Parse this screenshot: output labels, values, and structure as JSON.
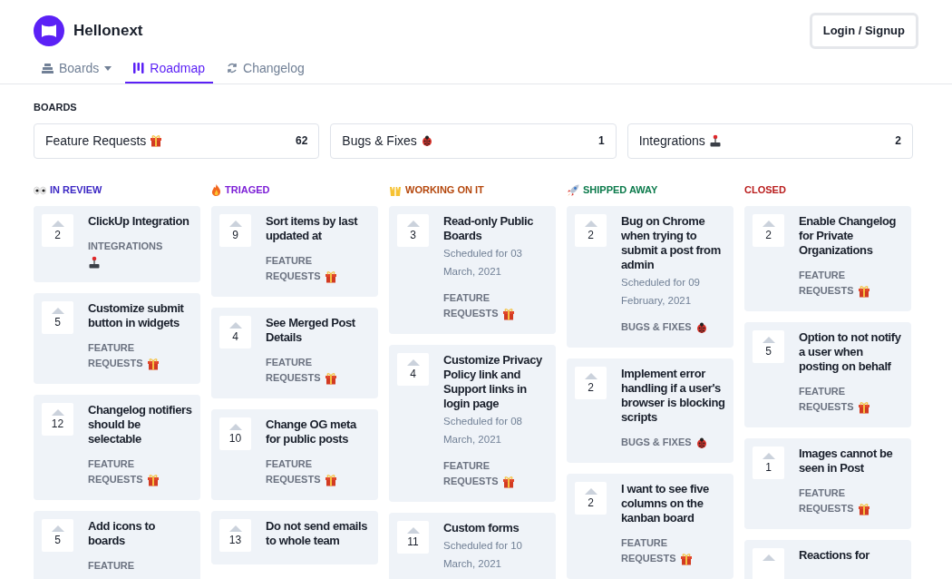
{
  "brand": {
    "name": "Hellonext"
  },
  "login_button": "Login / Signup",
  "nav_tabs": [
    {
      "label": "Boards",
      "kind": "boards",
      "selected": false
    },
    {
      "label": "Roadmap",
      "kind": "roadmap",
      "selected": true
    },
    {
      "label": "Changelog",
      "kind": "changelog",
      "selected": false
    }
  ],
  "boards_heading": "BOARDS",
  "boards": [
    {
      "name": "Feature Requests",
      "kind": "gift",
      "count": "62"
    },
    {
      "name": "Bugs & Fixes",
      "kind": "ladybug",
      "count": "1"
    },
    {
      "name": "Integrations",
      "kind": "joystick",
      "count": "2"
    }
  ],
  "columns": [
    {
      "title": "IN REVIEW",
      "kind": "eyes",
      "color": "#3b27c4",
      "cards": [
        {
          "votes": "2",
          "title": "ClickUp Integration",
          "board": "INTEGRATIONS",
          "kind": "joystick"
        },
        {
          "votes": "5",
          "title": "Customize submit button in widgets",
          "board": "FEATURE REQUESTS",
          "kind": "gift"
        },
        {
          "votes": "12",
          "title": "Changelog notifiers should be selectable",
          "board": "FEATURE REQUESTS",
          "kind": "gift"
        },
        {
          "votes": "5",
          "title": "Add icons to boards",
          "board": "FEATURE",
          "kind": "none"
        }
      ]
    },
    {
      "title": "TRIAGED",
      "kind": "fire",
      "color": "#7c1fd6",
      "cards": [
        {
          "votes": "9",
          "title": "Sort items by last updated at",
          "board": "FEATURE REQUESTS",
          "kind": "gift"
        },
        {
          "votes": "4",
          "title": "See Merged Post Details",
          "board": "FEATURE REQUESTS",
          "kind": "gift"
        },
        {
          "votes": "10",
          "title": "Change OG meta for public posts",
          "board": "FEATURE REQUESTS",
          "kind": "gift"
        },
        {
          "votes": "13",
          "title": "Do not send emails to whole team"
        }
      ]
    },
    {
      "title": "WORKING ON IT",
      "kind": "hands",
      "color": "#b4460b",
      "cards": [
        {
          "votes": "3",
          "title": "Read-only Public Boards",
          "schedule": "Scheduled for 03 March, 2021",
          "board": "FEATURE REQUESTS",
          "kind": "gift"
        },
        {
          "votes": "4",
          "title": "Customize Privacy Policy link and Support links in login page",
          "schedule": "Scheduled for 08 March, 2021",
          "board": "FEATURE REQUESTS",
          "kind": "gift"
        },
        {
          "votes": "11",
          "title": "Custom forms",
          "schedule": "Scheduled for 10 March, 2021"
        }
      ]
    },
    {
      "title": "SHIPPED AWAY",
      "kind": "rocket",
      "color": "#0b7a4b",
      "cards": [
        {
          "votes": "2",
          "title": "Bug on Chrome when trying to submit a post from admin",
          "schedule": "Scheduled for 09 February, 2021",
          "board": "BUGS & FIXES",
          "kind": "ladybug"
        },
        {
          "votes": "2",
          "title": "Implement error handling if a user's browser is blocking scripts",
          "board": "BUGS & FIXES",
          "kind": "ladybug"
        },
        {
          "votes": "2",
          "title": "I want to see five columns on the kanban board",
          "board": "FEATURE REQUESTS",
          "kind": "gift"
        }
      ]
    },
    {
      "title": "CLOSED",
      "kind": "none",
      "color": "#b91c1c",
      "cards": [
        {
          "votes": "2",
          "title": "Enable Changelog for Private Organizations",
          "board": "FEATURE REQUESTS",
          "kind": "gift"
        },
        {
          "votes": "5",
          "title": "Option to not notify a user when posting on behalf",
          "board": "FEATURE REQUESTS",
          "kind": "gift"
        },
        {
          "votes": "1",
          "title": "Images cannot be seen in Post",
          "board": "FEATURE REQUESTS",
          "kind": "gift"
        },
        {
          "title": "Reactions for"
        }
      ]
    }
  ]
}
